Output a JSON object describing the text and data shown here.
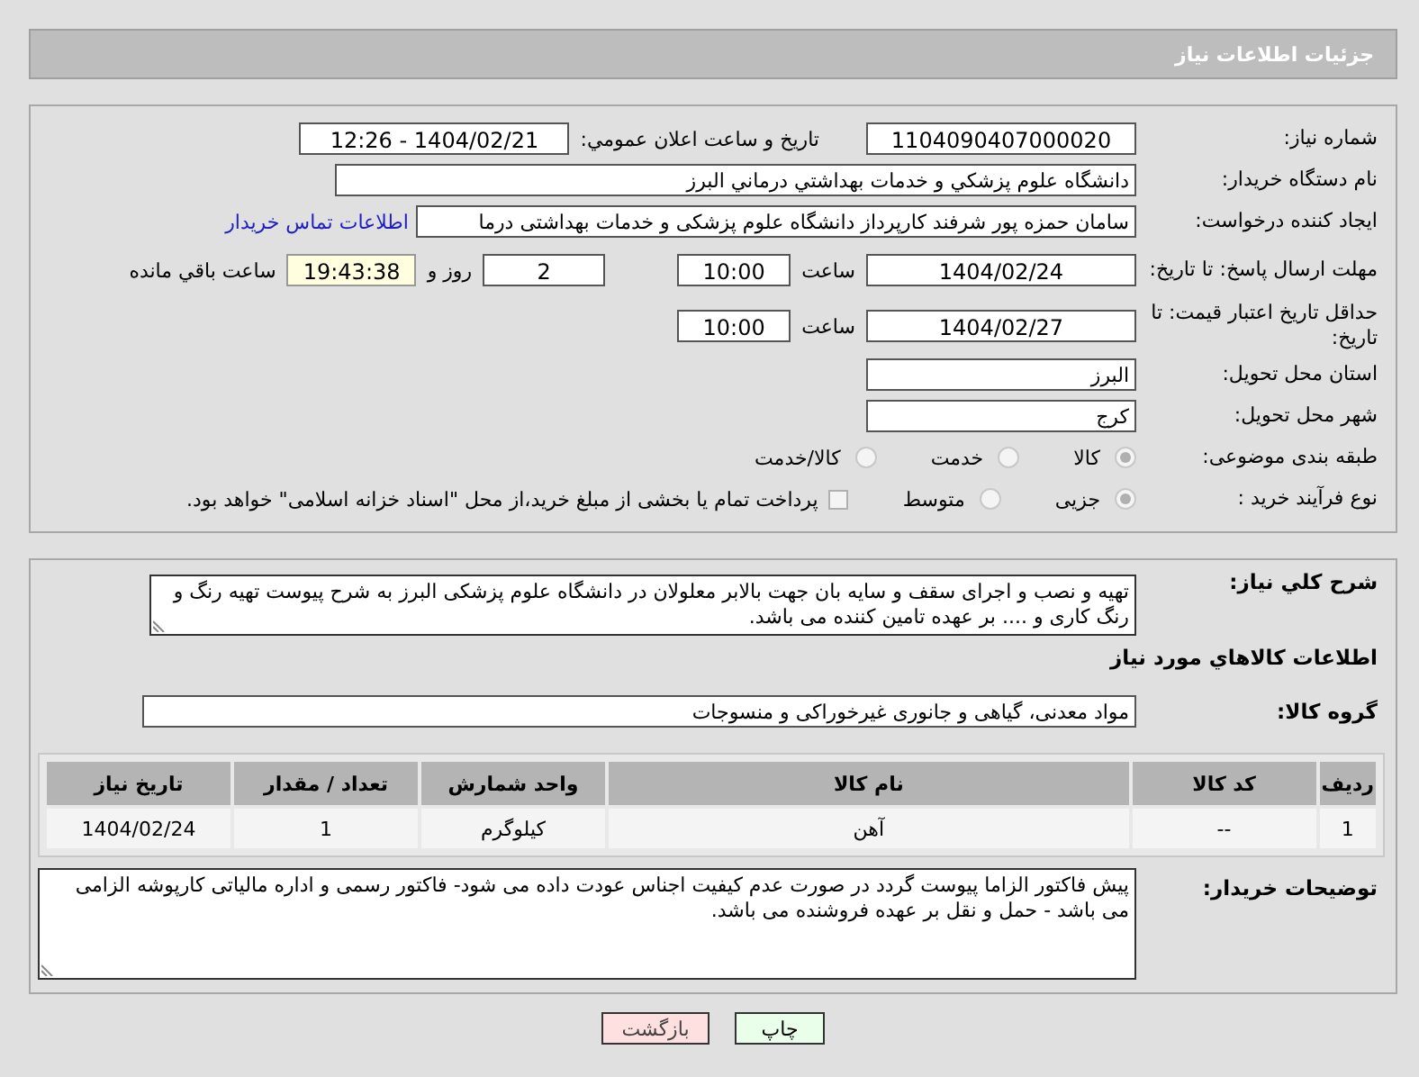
{
  "header": {
    "title": "جزئیات اطلاعات نیاز"
  },
  "need_number": {
    "label": "شماره نیاز:",
    "value": "1104090407000020"
  },
  "announce": {
    "label": "تاریخ و ساعت اعلان عمومي:",
    "value": "1404/02/21 - 12:26"
  },
  "buyer": {
    "label": "نام دستگاه خریدار:",
    "value": "دانشگاه علوم پزشكي و خدمات بهداشتي  درماني البرز"
  },
  "requester": {
    "label": "ایجاد کننده درخواست:",
    "value": "سامان حمزه پور شرفند کارپرداز دانشگاه علوم پزشکی و خدمات بهداشتی  درما",
    "link": "اطلاعات تماس خریدار"
  },
  "deadline": {
    "label": "مهلت ارسال پاسخ: تا تاریخ:",
    "date": "1404/02/24",
    "time_label": "ساعت",
    "time": "10:00",
    "days": "2",
    "days_label": "روز و",
    "remaining": "19:43:38",
    "remaining_label": "ساعت باقي مانده"
  },
  "validity": {
    "label": "حداقل تاریخ اعتبار قیمت: تا تاریخ:",
    "date": "1404/02/27",
    "time_label": "ساعت",
    "time": "10:00"
  },
  "province": {
    "label": "استان محل تحویل:",
    "value": "البرز"
  },
  "city": {
    "label": "شهر محل تحویل:",
    "value": "کرج"
  },
  "category": {
    "label": "طبقه بندی موضوعی:",
    "options": [
      {
        "label": "كالا",
        "selected": true
      },
      {
        "label": "خدمت",
        "selected": false
      },
      {
        "label": "كالا/خدمت",
        "selected": false
      }
    ]
  },
  "process": {
    "label": "نوع فرآیند خرید :",
    "options": [
      {
        "label": "جزیی",
        "selected": true
      },
      {
        "label": "متوسط",
        "selected": false
      }
    ],
    "treasury": {
      "label": "پرداخت تمام یا بخشی از مبلغ خرید،از محل \"اسناد خزانه اسلامی\" خواهد بود.",
      "checked": false
    }
  },
  "description": {
    "label": "شرح کلي نیاز:",
    "value": "تهیه و نصب و اجرای سقف و سایه بان جهت بالابر معلولان در دانشگاه علوم پزشکی البرز به شرح پیوست تهیه رنگ و رنگ کاری و .... بر عهده تامین کننده می باشد."
  },
  "goods_title": "اطلاعات کالاهاي مورد نیاز",
  "goods_group": {
    "label": "گروه کالا:",
    "value": "مواد معدنی، گیاهی و جانوری غیرخوراکی و منسوجات"
  },
  "table": {
    "columns": [
      "ردیف",
      "کد کالا",
      "نام کالا",
      "واحد شمارش",
      "تعداد / مقدار",
      "تاریخ نیاز"
    ],
    "rows": [
      [
        "1",
        "--",
        "آهن",
        "کیلوگرم",
        "1",
        "1404/02/24"
      ]
    ]
  },
  "buyer_notes": {
    "label": "توضیحات خریدار:",
    "value": "پیش فاکتور الزاما پیوست گردد در صورت عدم کیفیت اجناس عودت داده می شود- فاکتور رسمی و اداره مالیاتی کارپوشه الزامی می باشد - حمل و نقل بر عهده فروشنده می باشد."
  },
  "buttons": [
    {
      "label": "چاپ",
      "kind": "print"
    },
    {
      "label": "بازگشت",
      "kind": "back"
    }
  ]
}
